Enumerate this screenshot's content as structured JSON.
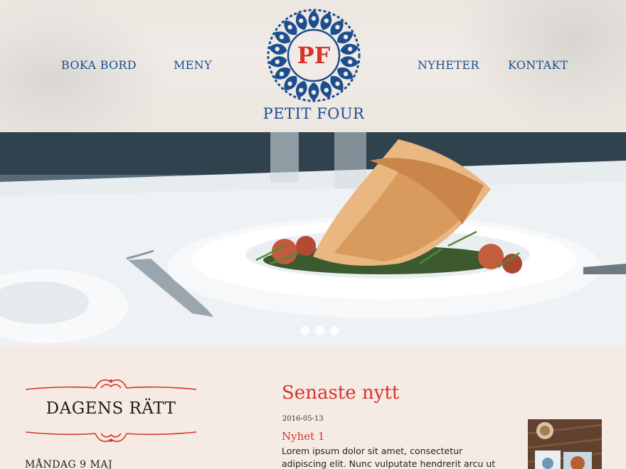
{
  "nav": {
    "left": [
      {
        "label": "BOKA BORD"
      },
      {
        "label": "MENY"
      }
    ],
    "right": [
      {
        "label": "NYHETER"
      },
      {
        "label": "KONTAKT"
      }
    ]
  },
  "brand": {
    "monogram": "PF",
    "name": "PETIT FOUR",
    "primary_color": "#1c4e8f",
    "accent_color": "#d6332b"
  },
  "hero": {
    "image": "plated-crepe-dish",
    "slide_count": 3,
    "active_slide": 1
  },
  "dish_of_day": {
    "title": "DAGENS RÄTT",
    "day": "MÅNDAG 9 MAJ"
  },
  "news": {
    "heading": "Senaste nytt",
    "items": [
      {
        "date": "2016-05-13",
        "title": "Nyhet 1",
        "body": "Lorem ipsum dolor sit amet, consectetur adipiscing elit. Nunc vulputate hendrerit arcu ut scelerisque."
      }
    ]
  }
}
